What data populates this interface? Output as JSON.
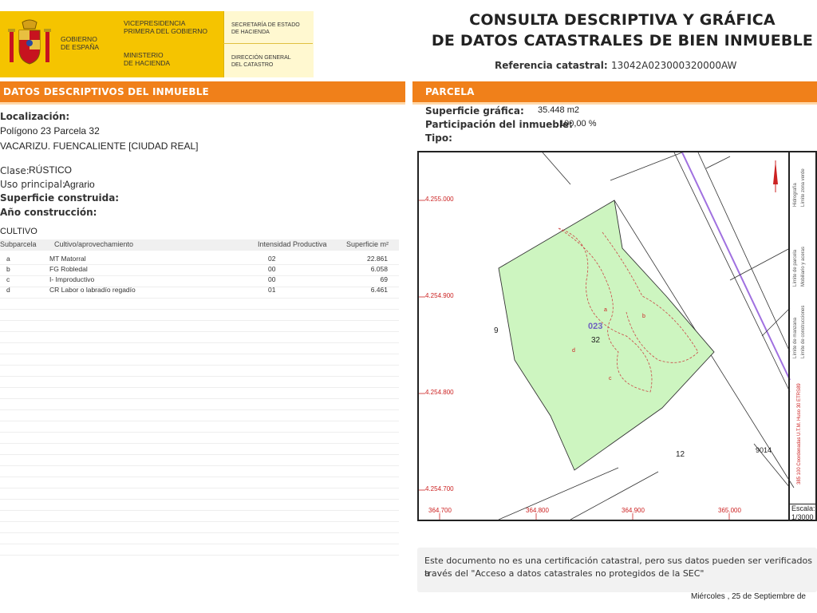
{
  "header": {
    "gov_line1": "GOBIERNO",
    "gov_line2": "DE ESPAÑA",
    "vp_line1": "VICEPRESIDENCIA",
    "vp_line2": "PRIMERA DEL GOBIERNO",
    "min_line1": "MINISTERIO",
    "min_line2": "DE HACIENDA",
    "sec_line1": "SECRETARÍA DE ESTADO",
    "sec_line2": "DE HACIENDA",
    "dir_line1": "DIRECCIÓN GENERAL",
    "dir_line2": "DEL CATASTRO",
    "title_line1": "CONSULTA DESCRIPTIVA Y GRÁFICA",
    "title_line2": "DE DATOS CATASTRALES DE BIEN INMUEBLE",
    "ref_label": "Referencia catastral:",
    "ref_value": "13042A023000320000AW"
  },
  "left": {
    "section_title": "DATOS DESCRIPTIVOS DEL INMUEBLE",
    "loc_label": "Localización:",
    "loc_line1": "Polígono 23 Parcela 32",
    "loc_line2": "VACARIZU. FUENCALIENTE [CIUDAD REAL]",
    "clase_label": "Clase:",
    "clase_value": "RÚSTICO",
    "uso_label": "Uso principal:",
    "uso_value": "Agrario",
    "sup_label": "Superficie construida:",
    "anio_label": "Año construcción:",
    "cultivo_title": "CULTIVO",
    "table": {
      "headers": [
        "Subparcela",
        "Cultivo/aprovechamiento",
        "Intensidad Productiva",
        "Superficie m²"
      ],
      "rows": [
        {
          "sub": "a",
          "cultivo": "MT Matorral",
          "intensidad": "02",
          "superficie": "22.861"
        },
        {
          "sub": "b",
          "cultivo": "FG Robledal",
          "intensidad": "00",
          "superficie": "6.058"
        },
        {
          "sub": "c",
          "cultivo": "I- Improductivo",
          "intensidad": "00",
          "superficie": "69"
        },
        {
          "sub": "d",
          "cultivo": "CR Labor o labradío regadío",
          "intensidad": "01",
          "superficie": "6.461"
        }
      ]
    }
  },
  "right": {
    "section_title": "PARCELA",
    "sup_grafica_label": "Superficie gráfica:",
    "sup_grafica_value": "35.448 m2",
    "part_label": "Participación del inmueble:",
    "part_value": "100,00 %",
    "tipo_label": "Tipo:",
    "map": {
      "y_labels": [
        "4.255.000",
        "4.254.900",
        "4.254.800",
        "4.254.700"
      ],
      "x_labels": [
        "364.700",
        "364.800",
        "364.900",
        "365.000"
      ],
      "polygon_code": "023",
      "parcel_number": "32",
      "neighbor_9": "9",
      "neighbor_12": "12",
      "neighbor_9014": "9014",
      "sub_a": "a",
      "sub_b": "b",
      "sub_c": "c",
      "sub_d": "d",
      "scale_label": "Escala:",
      "scale_value": "1/3000",
      "legend": [
        "Límite de parcela",
        "Mobiliario y aceras",
        "Hidrografía",
        "Límite zona verde",
        "Límite de manzana",
        "Límite de construcciones",
        "385 100 Coordenadas U.T.M. Huso 30 ETRS89"
      ]
    },
    "note_line1": "Este documento no es una certificación catastral, pero sus datos pueden ser verificados a",
    "note_line2": "través del \"Acceso a datos catastrales no protegidos de la SEC\"",
    "date": "Miércoles , 25 de Septiembre de"
  },
  "colors": {
    "accent_orange": "#f0801a",
    "gov_yellow": "#f5c400",
    "parcel_green": "#cdf5c0",
    "road_purple": "#a070e0",
    "coord_red": "#cc2222"
  }
}
